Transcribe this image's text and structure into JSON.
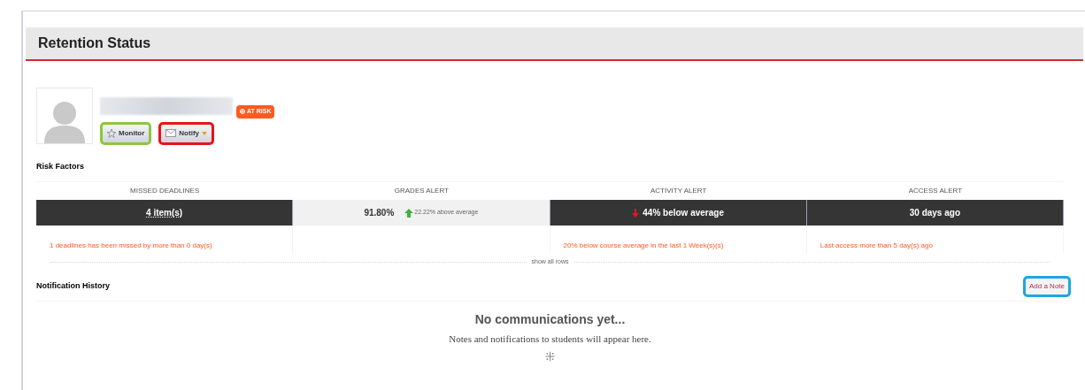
{
  "header": {
    "title": "Retention Status"
  },
  "student": {
    "badge": "AT RISK",
    "buttons": [
      {
        "kind": "star",
        "label": "Monitor",
        "color": "#8cc63f"
      },
      {
        "kind": "mail",
        "label": "Notify",
        "color": "#e8141b"
      }
    ]
  },
  "risk_factors": {
    "title": "Risk Factors",
    "columns": [
      {
        "heading": "MISSED DEADLINES",
        "alert": true,
        "value": "4 item(s)",
        "kind": "plain",
        "detail": "1 deadlines has been missed by more than 0 day(s)"
      },
      {
        "heading": "GRADES ALERT",
        "alert": false,
        "value": "91.80%",
        "kind": "up",
        "trend_text": "22.22% above average"
      },
      {
        "heading": "ACTIVITY ALERT",
        "alert": true,
        "value": "44% below average",
        "kind": "down",
        "detail": "20% below course average in the last 1 Week(s)(s)"
      },
      {
        "heading": "ACCESS ALERT",
        "alert": true,
        "value": "30 days ago",
        "kind": "plain",
        "detail": "Last access more than 5 day(s) ago"
      }
    ],
    "show_all": "show all rows"
  },
  "notifications": {
    "title": "Notification History",
    "add_button": {
      "label": "Add a Note",
      "color": "#1ea7e1"
    },
    "empty_title": "No communications yet...",
    "empty_text": "Notes and notifications to students will appear here.",
    "empty_mark": "⁜"
  }
}
